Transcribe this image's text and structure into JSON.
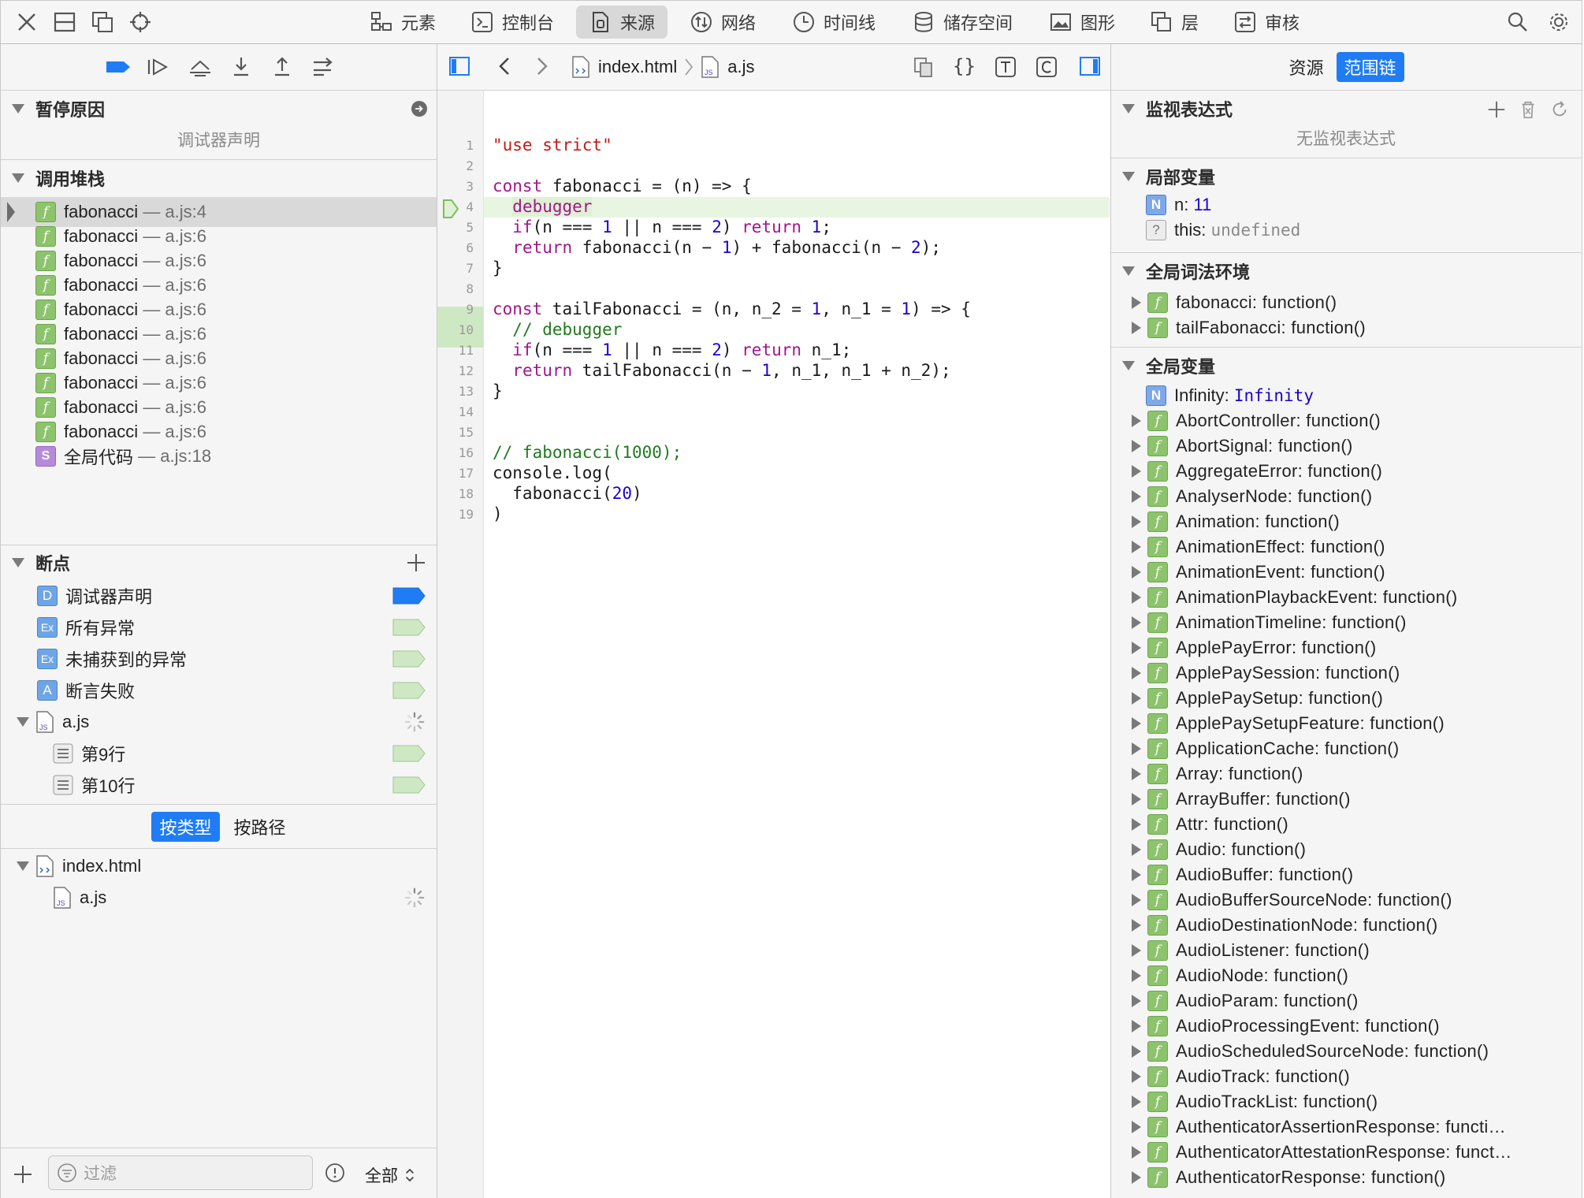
{
  "toolbar": {
    "tabs": [
      "元素",
      "控制台",
      "来源",
      "网络",
      "时间线",
      "储存空间",
      "图形",
      "层",
      "审核"
    ],
    "active_tab": "来源"
  },
  "left": {
    "pause_reason": {
      "title": "暂停原因",
      "detail": "调试器声明"
    },
    "call_stack": {
      "title": "调用堆栈",
      "frames": [
        {
          "name": "fabonacci",
          "loc": "— a.js:4"
        },
        {
          "name": "fabonacci",
          "loc": "— a.js:6"
        },
        {
          "name": "fabonacci",
          "loc": "— a.js:6"
        },
        {
          "name": "fabonacci",
          "loc": "— a.js:6"
        },
        {
          "name": "fabonacci",
          "loc": "— a.js:6"
        },
        {
          "name": "fabonacci",
          "loc": "— a.js:6"
        },
        {
          "name": "fabonacci",
          "loc": "— a.js:6"
        },
        {
          "name": "fabonacci",
          "loc": "— a.js:6"
        },
        {
          "name": "fabonacci",
          "loc": "— a.js:6"
        },
        {
          "name": "fabonacci",
          "loc": "— a.js:6"
        },
        {
          "name": "全局代码",
          "loc": "— a.js:18"
        }
      ]
    },
    "breakpoints": {
      "title": "断点",
      "items": [
        {
          "badge": "D",
          "label": "调试器声明"
        },
        {
          "badge": "Ex",
          "label": "所有异常"
        },
        {
          "badge": "Ex",
          "label": "未捕获到的异常"
        },
        {
          "badge": "A",
          "label": "断言失败"
        }
      ],
      "file": "a.js",
      "lines": [
        "第9行",
        "第10行"
      ]
    },
    "resources": {
      "mode_by_type": "按类型",
      "mode_by_path": "按路径",
      "root": "index.html",
      "child": "a.js"
    },
    "filter": {
      "placeholder": "过滤",
      "scope": "全部"
    }
  },
  "editor": {
    "breadcrumb": [
      "index.html",
      "a.js"
    ],
    "line_numbers": [
      "1",
      "2",
      "3",
      "4",
      "5",
      "6",
      "7",
      "8",
      "9",
      "10",
      "11",
      "12",
      "13",
      "14",
      "15",
      "16",
      "17",
      "18",
      "19"
    ]
  },
  "right": {
    "tabs": [
      "资源",
      "范围链"
    ],
    "active_tab": "范围链",
    "watch": {
      "title": "监视表达式",
      "empty": "无监视表达式"
    },
    "locals": {
      "title": "局部变量",
      "items": [
        {
          "badge": "N",
          "key": "n:",
          "value": "11"
        },
        {
          "badge": "?",
          "key": "this:",
          "value": "undefined"
        }
      ]
    },
    "global_lexical": {
      "title": "全局词法环境",
      "items": [
        "fabonacci: function()",
        "tailFabonacci: function()"
      ]
    },
    "globals": {
      "title": "全局变量",
      "infinity_key": "Infinity:",
      "infinity_value": "Infinity",
      "items": [
        "AbortController: function()",
        "AbortSignal: function()",
        "AggregateError: function()",
        "AnalyserNode: function()",
        "Animation: function()",
        "AnimationEffect: function()",
        "AnimationEvent: function()",
        "AnimationPlaybackEvent: function()",
        "AnimationTimeline: function()",
        "ApplePayError: function()",
        "ApplePaySession: function()",
        "ApplePaySetup: function()",
        "ApplePaySetupFeature: function()",
        "ApplicationCache: function()",
        "Array: function()",
        "ArrayBuffer: function()",
        "Attr: function()",
        "Audio: function()",
        "AudioBuffer: function()",
        "AudioBufferSourceNode: function()",
        "AudioDestinationNode: function()",
        "AudioListener: function()",
        "AudioNode: function()",
        "AudioParam: function()",
        "AudioProcessingEvent: function()",
        "AudioScheduledSourceNode: function()",
        "AudioTrack: function()",
        "AudioTrackList: function()",
        "AuthenticatorAssertionResponse: functi…",
        "AuthenticatorAttestationResponse: funct…",
        "AuthenticatorResponse: function()"
      ]
    }
  },
  "colors": {
    "accent": "#1f7cf5",
    "breakpoint_green": "#cfe8c4",
    "paused_line": "#e8f5e1"
  }
}
